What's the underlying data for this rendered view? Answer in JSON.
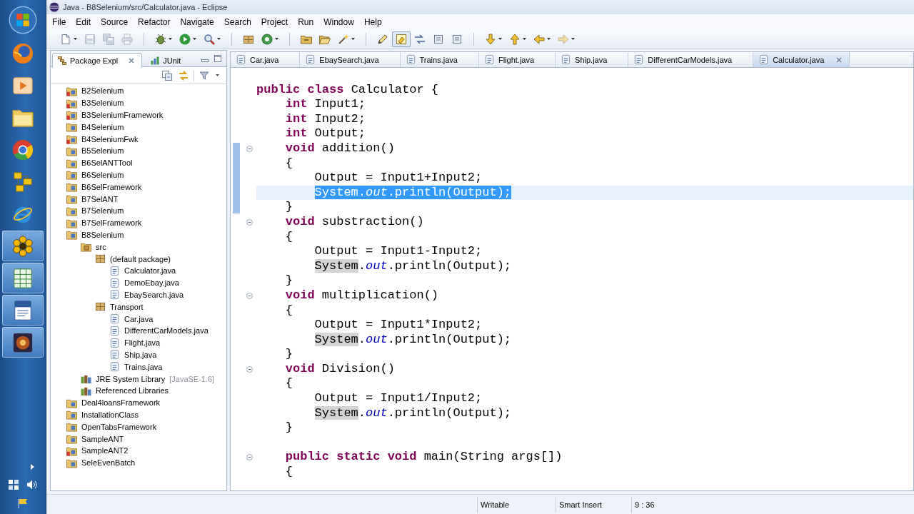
{
  "taskbar": {
    "items": [
      {
        "kind": "globe",
        "running": false
      },
      {
        "kind": "media",
        "running": false
      },
      {
        "kind": "folder",
        "running": false
      },
      {
        "kind": "wheel",
        "running": false
      },
      {
        "kind": "blocks",
        "running": false
      },
      {
        "kind": "e-globe",
        "running": false
      },
      {
        "kind": "flower",
        "running": true
      },
      {
        "kind": "sheet",
        "running": true
      },
      {
        "kind": "document",
        "running": true
      },
      {
        "kind": "app",
        "running": true
      }
    ]
  },
  "window": {
    "title": "Java - B8Selenium/src/Calculator.java - Eclipse"
  },
  "menu": [
    "File",
    "Edit",
    "Source",
    "Refactor",
    "Navigate",
    "Search",
    "Project",
    "Run",
    "Window",
    "Help"
  ],
  "toolbar": {
    "groups": [
      {
        "items": [
          {
            "kind": "new",
            "dropdown": true,
            "disabled": false,
            "pressed": false
          },
          {
            "kind": "save",
            "dropdown": false,
            "disabled": true,
            "pressed": false
          },
          {
            "kind": "save-all",
            "dropdown": false,
            "disabled": true,
            "pressed": false
          },
          {
            "kind": "print",
            "dropdown": false,
            "disabled": true,
            "pressed": false
          }
        ]
      },
      {
        "items": [
          {
            "kind": "debug",
            "dropdown": true,
            "disabled": false,
            "pressed": false
          },
          {
            "kind": "run",
            "dropdown": true,
            "disabled": false,
            "pressed": false
          },
          {
            "kind": "search",
            "dropdown": true,
            "disabled": false,
            "pressed": false
          }
        ]
      },
      {
        "items": [
          {
            "kind": "package",
            "dropdown": false,
            "disabled": false,
            "pressed": false
          },
          {
            "kind": "class",
            "dropdown": true,
            "disabled": false,
            "pressed": false
          }
        ]
      },
      {
        "items": [
          {
            "kind": "open-type",
            "dropdown": false,
            "disabled": false,
            "pressed": false
          },
          {
            "kind": "open-task",
            "dropdown": false,
            "disabled": false,
            "pressed": false
          },
          {
            "kind": "wand",
            "dropdown": true,
            "disabled": false,
            "pressed": false
          }
        ]
      },
      {
        "items": [
          {
            "kind": "annotation",
            "dropdown": false,
            "disabled": false,
            "pressed": false
          },
          {
            "kind": "highlight",
            "dropdown": false,
            "disabled": false,
            "pressed": true
          },
          {
            "kind": "link",
            "dropdown": false,
            "disabled": false,
            "pressed": false
          },
          {
            "kind": "block",
            "dropdown": false,
            "disabled": false,
            "pressed": false
          },
          {
            "kind": "block",
            "dropdown": false,
            "disabled": false,
            "pressed": false
          }
        ]
      },
      {
        "items": [
          {
            "kind": "next-annotation",
            "dropdown": true,
            "disabled": false,
            "pressed": false
          },
          {
            "kind": "prev-annotation",
            "dropdown": true,
            "disabled": false,
            "pressed": false
          },
          {
            "kind": "back",
            "dropdown": true,
            "disabled": false,
            "pressed": false
          },
          {
            "kind": "forward",
            "dropdown": true,
            "disabled": true,
            "pressed": false
          }
        ]
      }
    ]
  },
  "side_panel": {
    "tabs": [
      {
        "label": "Package Expl",
        "kind": "packages",
        "selected": true
      },
      {
        "label": "JUnit",
        "kind": "tests",
        "selected": false
      }
    ],
    "tree": [
      {
        "label": "B2Selenium",
        "kind": "project",
        "error": true
      },
      {
        "label": "B3Selenium",
        "kind": "project",
        "error": true
      },
      {
        "label": "B3SeleniumFramework",
        "kind": "project",
        "error": true
      },
      {
        "label": "B4Selenium",
        "kind": "project",
        "error": false
      },
      {
        "label": "B4SeleniumFwk",
        "kind": "project",
        "error": true
      },
      {
        "label": "B5Selenium",
        "kind": "project",
        "error": false
      },
      {
        "label": "B6SelANTTool",
        "kind": "project",
        "error": false
      },
      {
        "label": "B6Selenium",
        "kind": "project",
        "error": false
      },
      {
        "label": "B6SelFramework",
        "kind": "project",
        "error": false
      },
      {
        "label": "B7SelANT",
        "kind": "project",
        "error": false
      },
      {
        "label": "B7Selenium",
        "kind": "project",
        "error": false
      },
      {
        "label": "B7SelFramework",
        "kind": "project",
        "error": false
      },
      {
        "label": "B8Selenium",
        "kind": "project",
        "error": false,
        "children": [
          {
            "label": "src",
            "kind": "source-folder",
            "children": [
              {
                "label": "(default package)",
                "kind": "package",
                "children": [
                  {
                    "label": "Calculator.java",
                    "kind": "java-file"
                  },
                  {
                    "label": "DemoEbay.java",
                    "kind": "java-file"
                  },
                  {
                    "label": "EbaySearch.java",
                    "kind": "java-file"
                  }
                ]
              },
              {
                "label": "Transport",
                "kind": "package",
                "children": [
                  {
                    "label": "Car.java",
                    "kind": "java-file"
                  },
                  {
                    "label": "DifferentCarModels.java",
                    "kind": "java-file"
                  },
                  {
                    "label": "Flight.java",
                    "kind": "java-file"
                  },
                  {
                    "label": "Ship.java",
                    "kind": "java-file"
                  },
                  {
                    "label": "Trains.java",
                    "kind": "java-file"
                  }
                ]
              }
            ]
          },
          {
            "label": "JRE System Library",
            "decoration": "[JavaSE-1.6]",
            "kind": "library"
          },
          {
            "label": "Referenced Libraries",
            "kind": "library"
          }
        ]
      },
      {
        "label": "Deal4loansFramework",
        "kind": "project",
        "error": false
      },
      {
        "label": "InstallationClass",
        "kind": "project",
        "error": false
      },
      {
        "label": "OpenTabsFramework",
        "kind": "project",
        "error": false
      },
      {
        "label": "SampleANT",
        "kind": "project",
        "error": false
      },
      {
        "label": "SampleANT2",
        "kind": "project",
        "error": true
      },
      {
        "label": "SeleEvenBatch",
        "kind": "project",
        "error": false
      }
    ]
  },
  "editor": {
    "tabs": [
      {
        "label": "Car.java",
        "selected": false
      },
      {
        "label": "EbaySearch.java",
        "selected": false
      },
      {
        "label": "Trains.java",
        "selected": false
      },
      {
        "label": "Flight.java",
        "selected": false
      },
      {
        "label": "Ship.java",
        "selected": false
      },
      {
        "label": "DifferentCarModels.java",
        "selected": false
      },
      {
        "label": "Calculator.java",
        "selected": true
      }
    ],
    "lines": [
      {
        "current": false,
        "fold": false,
        "in_range": false
      },
      {
        "segments": [
          {
            "kind": "plain",
            "text": "**public** **class** Calculator {"
          }
        ],
        "current": false,
        "fold": false,
        "in_range": false,
        "children": [
          {
            "segments": [
              {
                "kind": "plain",
                "text": "**int** Input1;"
              }
            ],
            "current": false,
            "fold": false,
            "in_range": false
          },
          {
            "segments": [
              {
                "kind": "plain",
                "text": "**int** Input2;"
              }
            ],
            "current": false,
            "fold": false,
            "in_range": false
          },
          {
            "segments": [
              {
                "kind": "plain",
                "text": "**int** Output;"
              }
            ],
            "current": false,
            "fold": false,
            "in_range": false
          },
          {
            "segments": [
              {
                "kind": "plain",
                "text": "**void** addition()"
              }
            ],
            "current": false,
            "fold": true,
            "in_range": true
          },
          {
            "segments": [
              {
                "kind": "plain",
                "text": "{"
              }
            ],
            "current": false,
            "fold": false,
            "in_range": true,
            "children": [
              {
                "segments": [
                  {
                    "kind": "plain",
                    "text": "Output = Input1+Input2;"
                  }
                ],
                "current": false,
                "fold": false,
                "in_range": true
              },
              {
                "segments": [
                  {
                    "kind": "selection",
                    "text": "System.*out*.println(Output);"
                  }
                ],
                "current": true,
                "fold": false,
                "in_range": true
              }
            ]
          },
          {
            "segments": [
              {
                "kind": "plain",
                "text": "}"
              }
            ],
            "current": false,
            "fold": false,
            "in_range": true
          },
          {
            "segments": [
              {
                "kind": "plain",
                "text": "**void** substraction()"
              }
            ],
            "current": false,
            "fold": true,
            "in_range": false
          },
          {
            "segments": [
              {
                "kind": "plain",
                "text": "{"
              }
            ],
            "current": false,
            "fold": false,
            "in_range": false,
            "children": [
              {
                "segments": [
                  {
                    "kind": "plain",
                    "text": "Output = Input1-Input2;"
                  }
                ],
                "current": false,
                "fold": false,
                "in_range": false
              },
              {
                "segments": [
                  {
                    "kind": "occurrence",
                    "text": "System"
                  },
                  {
                    "kind": "plain",
                    "text": ".*out*.println(Output);"
                  }
                ],
                "current": false,
                "fold": false,
                "in_range": false
              }
            ]
          },
          {
            "segments": [
              {
                "kind": "plain",
                "text": "}"
              }
            ],
            "current": false,
            "fold": false,
            "in_range": false
          },
          {
            "segments": [
              {
                "kind": "plain",
                "text": "**void** multiplication()"
              }
            ],
            "current": false,
            "fold": true,
            "in_range": false
          },
          {
            "segments": [
              {
                "kind": "plain",
                "text": "{"
              }
            ],
            "current": false,
            "fold": false,
            "in_range": false,
            "children": [
              {
                "segments": [
                  {
                    "kind": "plain",
                    "text": "Output = Input1*Input2;"
                  }
                ],
                "current": false,
                "fold": false,
                "in_range": false
              },
              {
                "segments": [
                  {
                    "kind": "occurrence",
                    "text": "System"
                  },
                  {
                    "kind": "plain",
                    "text": ".*out*.println(Output);"
                  }
                ],
                "current": false,
                "fold": false,
                "in_range": false
              }
            ]
          },
          {
            "segments": [
              {
                "kind": "plain",
                "text": "}"
              }
            ],
            "current": false,
            "fold": false,
            "in_range": false
          },
          {
            "segments": [
              {
                "kind": "plain",
                "text": "**void** Division()"
              }
            ],
            "current": false,
            "fold": true,
            "in_range": false
          },
          {
            "segments": [
              {
                "kind": "plain",
                "text": "{"
              }
            ],
            "current": false,
            "fold": false,
            "in_range": false,
            "children": [
              {
                "segments": [
                  {
                    "kind": "plain",
                    "text": "Output = Input1/Input2;"
                  }
                ],
                "current": false,
                "fold": false,
                "in_range": false
              },
              {
                "segments": [
                  {
                    "kind": "occurrence",
                    "text": "System"
                  },
                  {
                    "kind": "plain",
                    "text": ".*out*.println(Output);"
                  }
                ],
                "current": false,
                "fold": false,
                "in_range": false
              }
            ]
          },
          {
            "segments": [
              {
                "kind": "plain",
                "text": "}"
              }
            ],
            "current": false,
            "fold": false,
            "in_range": false
          },
          {
            "current": false,
            "fold": false,
            "in_range": false
          },
          {
            "segments": [
              {
                "kind": "plain",
                "text": "**public** **static** **void** main(String args[])"
              }
            ],
            "current": false,
            "fold": true,
            "in_range": false
          },
          {
            "segments": [
              {
                "kind": "plain",
                "text": "{"
              }
            ],
            "current": false,
            "fold": false,
            "in_range": false
          }
        ]
      }
    ]
  },
  "status_bar": [
    "Writable",
    "Smart Insert",
    "9 : 36"
  ]
}
